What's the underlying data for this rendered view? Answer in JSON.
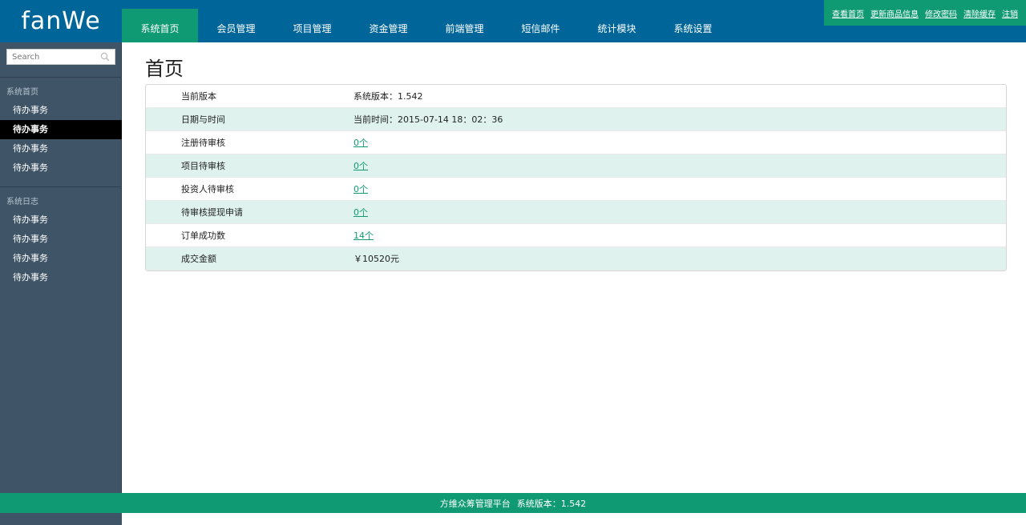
{
  "header": {
    "logo": "fanWe",
    "nav": [
      {
        "label": "系统首页",
        "active": true
      },
      {
        "label": "会员管理"
      },
      {
        "label": "项目管理"
      },
      {
        "label": "资金管理"
      },
      {
        "label": "前端管理"
      },
      {
        "label": "短信邮件"
      },
      {
        "label": "统计模块"
      },
      {
        "label": "系统设置"
      }
    ],
    "toplinks": [
      "查看首页",
      "更新商品信息",
      "修改密码",
      "清除缓存",
      "注销"
    ]
  },
  "sidebar": {
    "search_placeholder": "Search",
    "groups": [
      {
        "title": "系统首页",
        "items": [
          "待办事务",
          "待办事务",
          "待办事务",
          "待办事务"
        ],
        "active_index": 1
      },
      {
        "title": "系统日志",
        "items": [
          "待办事务",
          "待办事务",
          "待办事务",
          "待办事务"
        ]
      }
    ]
  },
  "main": {
    "title": "首页",
    "rows": [
      {
        "label": "当前版本",
        "value": "系统版本：1.542",
        "link": false
      },
      {
        "label": "日期与时间",
        "value": "当前时间：2015-07-14 18：02：36",
        "link": false
      },
      {
        "label": "注册待审核",
        "value": "0个",
        "link": true
      },
      {
        "label": "项目待审核",
        "value": "0个",
        "link": true
      },
      {
        "label": "投资人待审核",
        "value": "0个",
        "link": true
      },
      {
        "label": "待审核提现申请",
        "value": "0个",
        "link": true
      },
      {
        "label": "订单成功数",
        "value": "14个",
        "link": true
      },
      {
        "label": "成交金额",
        "value": "￥10520元",
        "link": false
      }
    ]
  },
  "footer": {
    "platform": "方维众筹管理平台",
    "version": "系统版本：1.542"
  },
  "colors": {
    "header_blue": "#006699",
    "accent_green": "#109a74",
    "sidebar_bg": "#3f5567",
    "row_alt": "#dff2ee"
  }
}
